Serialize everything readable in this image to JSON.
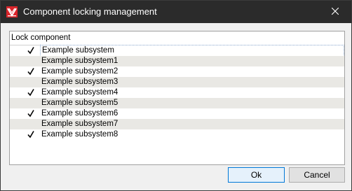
{
  "window": {
    "title": "Component locking management",
    "app_icon": "logo-icon",
    "close_icon": "close-icon"
  },
  "list": {
    "column_header": "Lock component",
    "rows": [
      {
        "label": "Example subsystem",
        "checked": true,
        "selected": true
      },
      {
        "label": "Example subsystem1",
        "checked": false,
        "selected": false
      },
      {
        "label": "Example subsystem2",
        "checked": true,
        "selected": false
      },
      {
        "label": "Example subsystem3",
        "checked": false,
        "selected": false
      },
      {
        "label": "Example subsystem4",
        "checked": true,
        "selected": false
      },
      {
        "label": "Example subsystem5",
        "checked": false,
        "selected": false
      },
      {
        "label": "Example subsystem6",
        "checked": true,
        "selected": false
      },
      {
        "label": "Example subsystem7",
        "checked": false,
        "selected": false
      },
      {
        "label": "Example subsystem8",
        "checked": true,
        "selected": false
      }
    ]
  },
  "buttons": {
    "ok": "Ok",
    "cancel": "Cancel"
  },
  "colors": {
    "titlebar": "#2b2b2b",
    "logo_red": "#d9242a",
    "alt_row": "#e9e8e4",
    "focus_blue": "#0078d7"
  }
}
